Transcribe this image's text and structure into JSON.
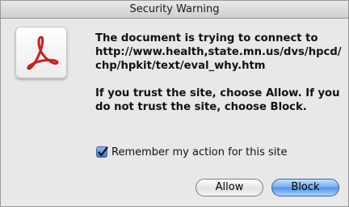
{
  "dialog": {
    "title": "Security Warning",
    "icon": "adobe-acrobat-icon",
    "message_line1": "The document is trying to connect to",
    "message_url": "http://www.health,state.mn.us/dvs/hpcd/chp/hpkit/text/eval_why.htm",
    "message_trust": "If you trust the site, choose Allow. If you do not trust the site, choose Block."
  },
  "remember": {
    "checked": true,
    "label": "Remember my action for this site"
  },
  "buttons": {
    "allow_label": "Allow",
    "block_label": "Block",
    "default": "block"
  },
  "colors": {
    "accent": "#5294e8",
    "acrobat_red": "#cc1f1f"
  }
}
